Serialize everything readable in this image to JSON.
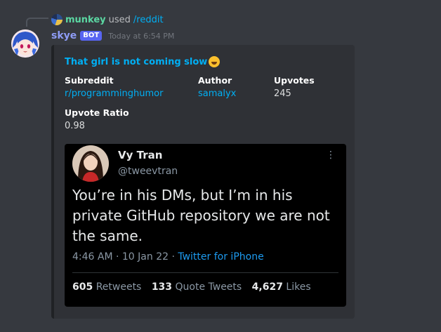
{
  "reply": {
    "username": "munkey",
    "verb": "used",
    "command": "/reddit"
  },
  "message": {
    "author": "skye",
    "bot_tag": "BOT",
    "timestamp": "Today at 6:54 PM"
  },
  "embed": {
    "title": "That girl is not coming slow",
    "title_emoji": "laughing-with-tears-emoji",
    "fields": {
      "subreddit": {
        "name": "Subreddit",
        "value": "r/programminghumor"
      },
      "author": {
        "name": "Author",
        "value": "samalyx"
      },
      "upvotes": {
        "name": "Upvotes",
        "value": "245"
      },
      "ratio": {
        "name": "Upvote Ratio",
        "value": "0.98"
      }
    },
    "tweet": {
      "name": "Vy Tran",
      "handle": "@tweevtran",
      "text": "You’re in his DMs, but I’m in his private GitHub repository we are not the same.",
      "time": "4:46 AM · 10 Jan 22 · ",
      "source": "Twitter for iPhone",
      "retweets_count": "605",
      "retweets_label": "Retweets",
      "quotes_count": "133",
      "quotes_label": "Quote Tweets",
      "likes_count": "4,627",
      "likes_label": "Likes"
    }
  },
  "colors": {
    "background": "#36393f",
    "embed_bg": "#2f3136",
    "link": "#00aff4",
    "bot_tag": "#5865f2",
    "twitter_blue": "#1d9bf0"
  }
}
